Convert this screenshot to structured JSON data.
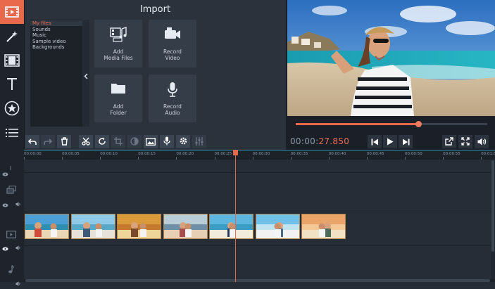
{
  "import": {
    "title": "Import",
    "categories": [
      {
        "label": "My files",
        "selected": true
      },
      {
        "label": "Sounds",
        "selected": false
      },
      {
        "label": "Music",
        "selected": false
      },
      {
        "label": "Sample video",
        "selected": false
      },
      {
        "label": "Backgrounds",
        "selected": false
      }
    ],
    "tiles": [
      {
        "line1": "Add",
        "line2": "Media Files",
        "icon": "media-files-icon"
      },
      {
        "line1": "Record",
        "line2": "Video",
        "icon": "camera-icon"
      },
      {
        "line1": "Add",
        "line2": "Folder",
        "icon": "folder-icon"
      },
      {
        "line1": "Record",
        "line2": "Audio",
        "icon": "microphone-icon"
      }
    ]
  },
  "sidebar_tools": [
    "video-import-icon",
    "magic-wand-icon",
    "film-transitions-icon",
    "text-titles-icon",
    "stickers-star-icon",
    "more-menu-icon"
  ],
  "player": {
    "timecode_prefix": "00:00:",
    "timecode_value": "27.850",
    "progress": 0.64
  },
  "timeline": {
    "ruler_ticks": [
      "00:00:00",
      "00:00:05",
      "00:00:10",
      "00:00:15",
      "00:00:20",
      "00:00:25",
      "00:00:30",
      "00:00:35",
      "00:00:40",
      "00:00:45",
      "00:00:50",
      "00:00:55",
      "00:01:00"
    ],
    "clip_count": 7
  },
  "colors": {
    "accent": "#e8694c",
    "timeline_line": "#2c97b5",
    "clip_border": "#b08448"
  }
}
